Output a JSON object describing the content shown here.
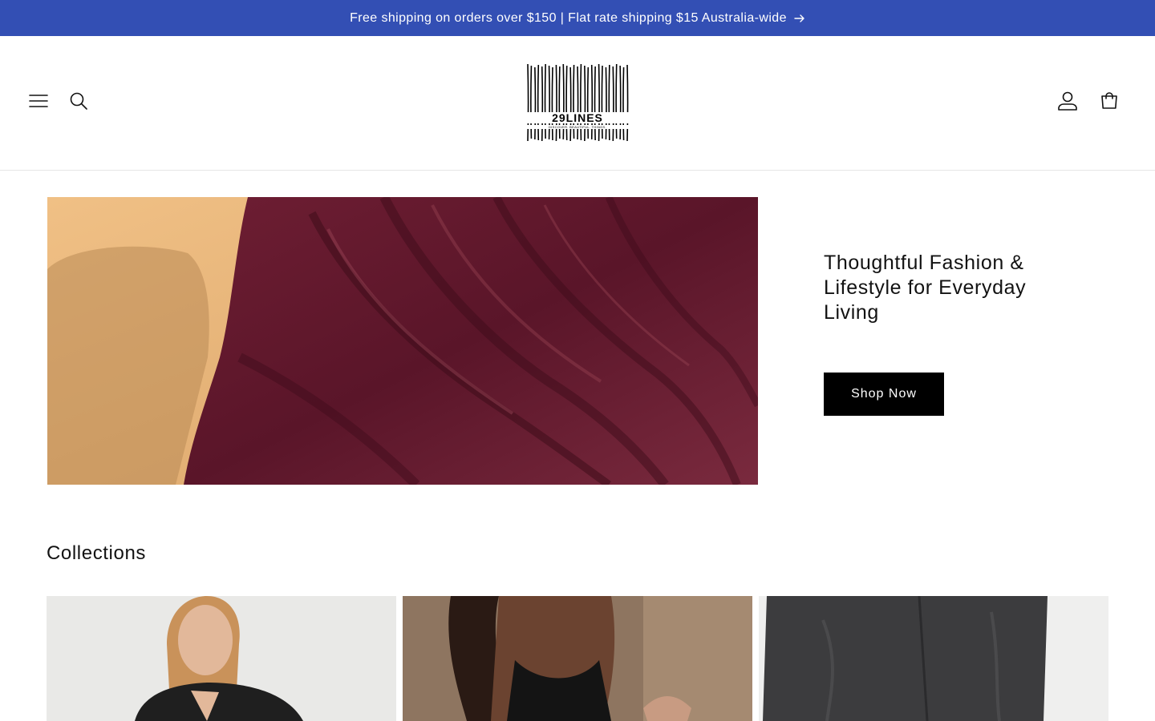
{
  "announcement": {
    "text": "Free shipping on orders over $150 | Flat rate shipping $15 Australia-wide"
  },
  "header": {
    "logo": {
      "name": "29LINES",
      "tagline": "DISCOVER. BEAUTIFUL. THINGS."
    }
  },
  "icons": {
    "menu": "hamburger-menu-icon",
    "search": "search-icon",
    "account": "user-icon",
    "cart": "shopping-bag-icon",
    "announcement_arrow": "arrow-right-icon"
  },
  "hero": {
    "title": "Thoughtful Fashion & Lifestyle for Everyday Living",
    "button_label": "Shop Now"
  },
  "collections": {
    "heading": "Collections"
  },
  "colors": {
    "announcement_bg": "#334fb4",
    "button_bg": "#000000",
    "text": "#121212"
  }
}
